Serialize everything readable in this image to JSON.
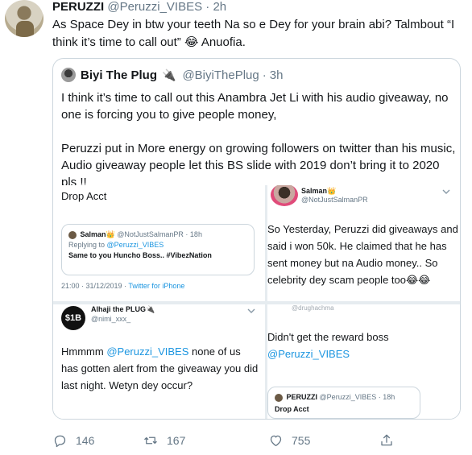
{
  "tweet": {
    "name": "PERUZZI",
    "handle": "@Peruzzi_VIBES",
    "dot": "·",
    "time": "2h",
    "text": "As Space Dey in btw your teeth Na so e Dey for your brain abi? Talmbout “I think it’s time to call out” 😂 Anuofia."
  },
  "quote": {
    "name": "Biyi The Plug",
    "emoji": "🔌",
    "handle": "@BiyiThePlug",
    "dot": "·",
    "time": "3h",
    "para1": "I think it’s time to call out this Anambra Jet Li with his audio giveaway, no one is forcing you to give people money,",
    "para2": "Peruzzi put in More energy on growing followers on twitter than his music, Audio giveaway people let this BS slide with 2019 don’t bring it to 2020 pls !!",
    "media": {
      "c1": {
        "top_text": "Drop Acct",
        "inner_name": "Salman👑",
        "inner_handle": "@NotJustSalmanPR · 18h",
        "inner_reply_prefix": "Replying to",
        "inner_reply_to": "@Peruzzi_VIBES",
        "inner_text": "Same to you Huncho Boss.. #VibezNation",
        "time": "21:00 · 31/12/2019 ·",
        "client": "Twitter for iPhone"
      },
      "c2": {
        "name": "Salman👑",
        "handle": "@NotJustSalmanPR",
        "text": "So Yesterday, Peruzzi did giveaways and said i won 50k. He claimed that he has sent money but na Audio money.. So celebrity dey scam people too😂😂"
      },
      "c3": {
        "avatar_text": "$1B",
        "name": "Alhaji the PLUG🔌",
        "handle": "@nimi_xxx_",
        "text_before": "Hmmmm ",
        "mention": "@Peruzzi_VIBES",
        "text_after": " none of us has gotten alert from the giveaway you did last night. Wetyn dey occur?"
      },
      "c4": {
        "ghost": "@drughachma",
        "text": "Didn't get the reward boss",
        "mention": "@Peruzzi_VIBES",
        "card_name": "PERUZZI",
        "card_handle": "@Peruzzi_VIBES · 18h",
        "card_text": "Drop Acct"
      }
    }
  },
  "actions": {
    "replies": "146",
    "retweets": "167",
    "likes": "755"
  },
  "icons": {
    "reply": "reply-icon",
    "retweet": "retweet-icon",
    "like": "heart-icon",
    "share": "share-icon",
    "chevron": "chevron-down-icon"
  },
  "colors": {
    "accent": "#1b95e0",
    "muted": "#657786",
    "border": "#ccd6dd"
  }
}
